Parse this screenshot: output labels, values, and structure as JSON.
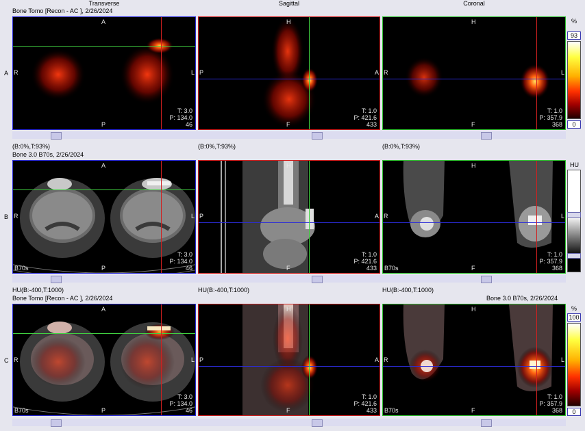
{
  "columns": {
    "transverse": "Transverse",
    "sagittal": "Sagittal",
    "coronal": "Coronal"
  },
  "rows": {
    "a": {
      "label": "A",
      "header": "Bone Tomo [Recon - AC ], 2/26/2024",
      "window_transverse": "(B:0%,T:93%)",
      "window_sagittal": "(B:0%,T:93%)",
      "window_coronal": "(B:0%,T:93%)",
      "scale_unit": "%",
      "scale_top": "93",
      "scale_bottom": "0"
    },
    "b": {
      "label": "B",
      "header": "Bone  3.0  B70s, 2/26/2024",
      "window_transverse": "HU(B:-400,T:1000)",
      "window_sagittal": "HU(B:-400,T:1000)",
      "window_coronal": "HU(B:-400,T:1000)",
      "scale_unit": "HU",
      "kernel": "B70s"
    },
    "c": {
      "label": "C",
      "header_left": "Bone Tomo [Recon - AC ], 2/26/2024",
      "header_right": "Bone  3.0  B70s, 2/26/2024",
      "scale_unit": "%",
      "scale_top": "100",
      "scale_bottom": "0",
      "kernel": "B70s"
    }
  },
  "orientation": {
    "transverse": {
      "top": "A",
      "bottom": "P",
      "left": "R",
      "right": "L"
    },
    "sagittal": {
      "top": "H",
      "bottom": "F",
      "left": "P",
      "right": "A"
    },
    "coronal": {
      "top": "H",
      "bottom": "F",
      "left": "R",
      "right": "L"
    }
  },
  "slice_info": {
    "transverse": {
      "t": "T: 3.0",
      "p": "P: 134.0",
      "n": "46"
    },
    "sagittal": {
      "t": "T: 1.0",
      "p": "P: 421.6",
      "n": "433"
    },
    "coronal": {
      "t": "T: 1.0",
      "p": "P: 357.9",
      "n": "368"
    }
  },
  "slider_positions": {
    "transverse": 0.24,
    "sagittal": 0.66,
    "coronal": 0.6
  },
  "colors": {
    "transverse_border": "#2b2bd8",
    "sagittal_border": "#d02020",
    "coronal_border": "#30c030",
    "hot_colormap": [
      "#ffffff",
      "#ffff40",
      "#ffb000",
      "#ff3000",
      "#a00000",
      "#200000"
    ],
    "gray_colormap": [
      "#ffffff",
      "#000000"
    ]
  }
}
